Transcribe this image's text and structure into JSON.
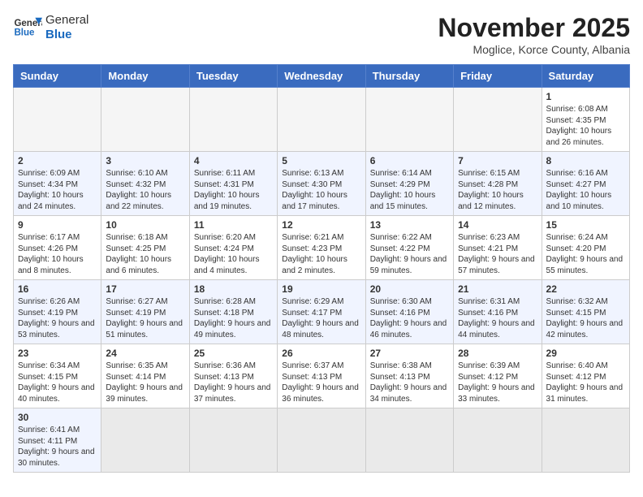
{
  "header": {
    "logo_general": "General",
    "logo_blue": "Blue",
    "month_title": "November 2025",
    "subtitle": "Moglice, Korce County, Albania"
  },
  "weekdays": [
    "Sunday",
    "Monday",
    "Tuesday",
    "Wednesday",
    "Thursday",
    "Friday",
    "Saturday"
  ],
  "weeks": [
    [
      {
        "day": "",
        "info": ""
      },
      {
        "day": "",
        "info": ""
      },
      {
        "day": "",
        "info": ""
      },
      {
        "day": "",
        "info": ""
      },
      {
        "day": "",
        "info": ""
      },
      {
        "day": "",
        "info": ""
      },
      {
        "day": "1",
        "info": "Sunrise: 6:08 AM\nSunset: 4:35 PM\nDaylight: 10 hours and 26 minutes."
      }
    ],
    [
      {
        "day": "2",
        "info": "Sunrise: 6:09 AM\nSunset: 4:34 PM\nDaylight: 10 hours and 24 minutes."
      },
      {
        "day": "3",
        "info": "Sunrise: 6:10 AM\nSunset: 4:32 PM\nDaylight: 10 hours and 22 minutes."
      },
      {
        "day": "4",
        "info": "Sunrise: 6:11 AM\nSunset: 4:31 PM\nDaylight: 10 hours and 19 minutes."
      },
      {
        "day": "5",
        "info": "Sunrise: 6:13 AM\nSunset: 4:30 PM\nDaylight: 10 hours and 17 minutes."
      },
      {
        "day": "6",
        "info": "Sunrise: 6:14 AM\nSunset: 4:29 PM\nDaylight: 10 hours and 15 minutes."
      },
      {
        "day": "7",
        "info": "Sunrise: 6:15 AM\nSunset: 4:28 PM\nDaylight: 10 hours and 12 minutes."
      },
      {
        "day": "8",
        "info": "Sunrise: 6:16 AM\nSunset: 4:27 PM\nDaylight: 10 hours and 10 minutes."
      }
    ],
    [
      {
        "day": "9",
        "info": "Sunrise: 6:17 AM\nSunset: 4:26 PM\nDaylight: 10 hours and 8 minutes."
      },
      {
        "day": "10",
        "info": "Sunrise: 6:18 AM\nSunset: 4:25 PM\nDaylight: 10 hours and 6 minutes."
      },
      {
        "day": "11",
        "info": "Sunrise: 6:20 AM\nSunset: 4:24 PM\nDaylight: 10 hours and 4 minutes."
      },
      {
        "day": "12",
        "info": "Sunrise: 6:21 AM\nSunset: 4:23 PM\nDaylight: 10 hours and 2 minutes."
      },
      {
        "day": "13",
        "info": "Sunrise: 6:22 AM\nSunset: 4:22 PM\nDaylight: 9 hours and 59 minutes."
      },
      {
        "day": "14",
        "info": "Sunrise: 6:23 AM\nSunset: 4:21 PM\nDaylight: 9 hours and 57 minutes."
      },
      {
        "day": "15",
        "info": "Sunrise: 6:24 AM\nSunset: 4:20 PM\nDaylight: 9 hours and 55 minutes."
      }
    ],
    [
      {
        "day": "16",
        "info": "Sunrise: 6:26 AM\nSunset: 4:19 PM\nDaylight: 9 hours and 53 minutes."
      },
      {
        "day": "17",
        "info": "Sunrise: 6:27 AM\nSunset: 4:19 PM\nDaylight: 9 hours and 51 minutes."
      },
      {
        "day": "18",
        "info": "Sunrise: 6:28 AM\nSunset: 4:18 PM\nDaylight: 9 hours and 49 minutes."
      },
      {
        "day": "19",
        "info": "Sunrise: 6:29 AM\nSunset: 4:17 PM\nDaylight: 9 hours and 48 minutes."
      },
      {
        "day": "20",
        "info": "Sunrise: 6:30 AM\nSunset: 4:16 PM\nDaylight: 9 hours and 46 minutes."
      },
      {
        "day": "21",
        "info": "Sunrise: 6:31 AM\nSunset: 4:16 PM\nDaylight: 9 hours and 44 minutes."
      },
      {
        "day": "22",
        "info": "Sunrise: 6:32 AM\nSunset: 4:15 PM\nDaylight: 9 hours and 42 minutes."
      }
    ],
    [
      {
        "day": "23",
        "info": "Sunrise: 6:34 AM\nSunset: 4:15 PM\nDaylight: 9 hours and 40 minutes."
      },
      {
        "day": "24",
        "info": "Sunrise: 6:35 AM\nSunset: 4:14 PM\nDaylight: 9 hours and 39 minutes."
      },
      {
        "day": "25",
        "info": "Sunrise: 6:36 AM\nSunset: 4:13 PM\nDaylight: 9 hours and 37 minutes."
      },
      {
        "day": "26",
        "info": "Sunrise: 6:37 AM\nSunset: 4:13 PM\nDaylight: 9 hours and 36 minutes."
      },
      {
        "day": "27",
        "info": "Sunrise: 6:38 AM\nSunset: 4:13 PM\nDaylight: 9 hours and 34 minutes."
      },
      {
        "day": "28",
        "info": "Sunrise: 6:39 AM\nSunset: 4:12 PM\nDaylight: 9 hours and 33 minutes."
      },
      {
        "day": "29",
        "info": "Sunrise: 6:40 AM\nSunset: 4:12 PM\nDaylight: 9 hours and 31 minutes."
      }
    ],
    [
      {
        "day": "30",
        "info": "Sunrise: 6:41 AM\nSunset: 4:11 PM\nDaylight: 9 hours and 30 minutes."
      },
      {
        "day": "",
        "info": ""
      },
      {
        "day": "",
        "info": ""
      },
      {
        "day": "",
        "info": ""
      },
      {
        "day": "",
        "info": ""
      },
      {
        "day": "",
        "info": ""
      },
      {
        "day": "",
        "info": ""
      }
    ]
  ]
}
